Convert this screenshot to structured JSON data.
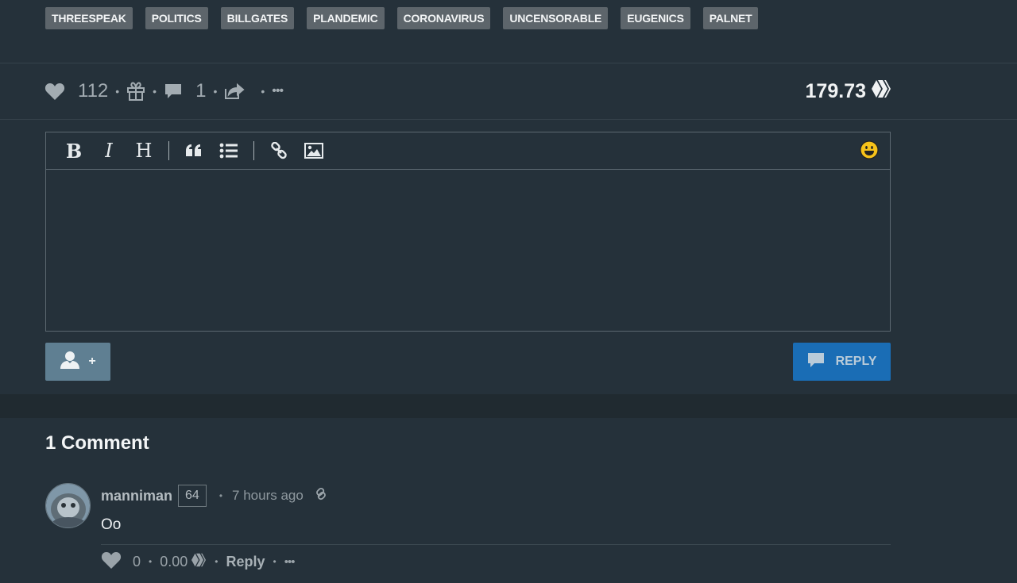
{
  "tags": [
    "THREESPEAK",
    "POLITICS",
    "BILLGATES",
    "PLANDEMIC",
    "CORONAVIRUS",
    "UNCENSORABLE",
    "EUGENICS",
    "PALNET"
  ],
  "post_actions": {
    "votes": "112",
    "comments": "1",
    "separator": "•",
    "more": "•••",
    "payout": "179.73",
    "icons": [
      "heart-icon",
      "gift-icon",
      "comment-icon",
      "share-icon",
      "more-icon",
      "hive-icon"
    ]
  },
  "editor": {
    "toolbar": {
      "bold": "B",
      "italic": "I",
      "heading": "H",
      "icons": [
        "quote-icon",
        "list-icon",
        "link-icon",
        "image-icon",
        "emoji-icon"
      ]
    },
    "body_value": ""
  },
  "buttons": {
    "beneficiary_label": "+",
    "reply_label": "REPLY"
  },
  "comments_section": {
    "title": "1 Comment",
    "comments": [
      {
        "author": "manniman",
        "reputation": "64",
        "time": "7 hours ago",
        "body": "Oo",
        "votes": "0",
        "payout": "0.00",
        "reply_label": "Reply",
        "more": "•••"
      }
    ]
  },
  "colors": {
    "background": "#25313a",
    "tag_bg": "#5d656b",
    "reply_button": "#1a6db5",
    "user_button": "#5f7f92"
  }
}
